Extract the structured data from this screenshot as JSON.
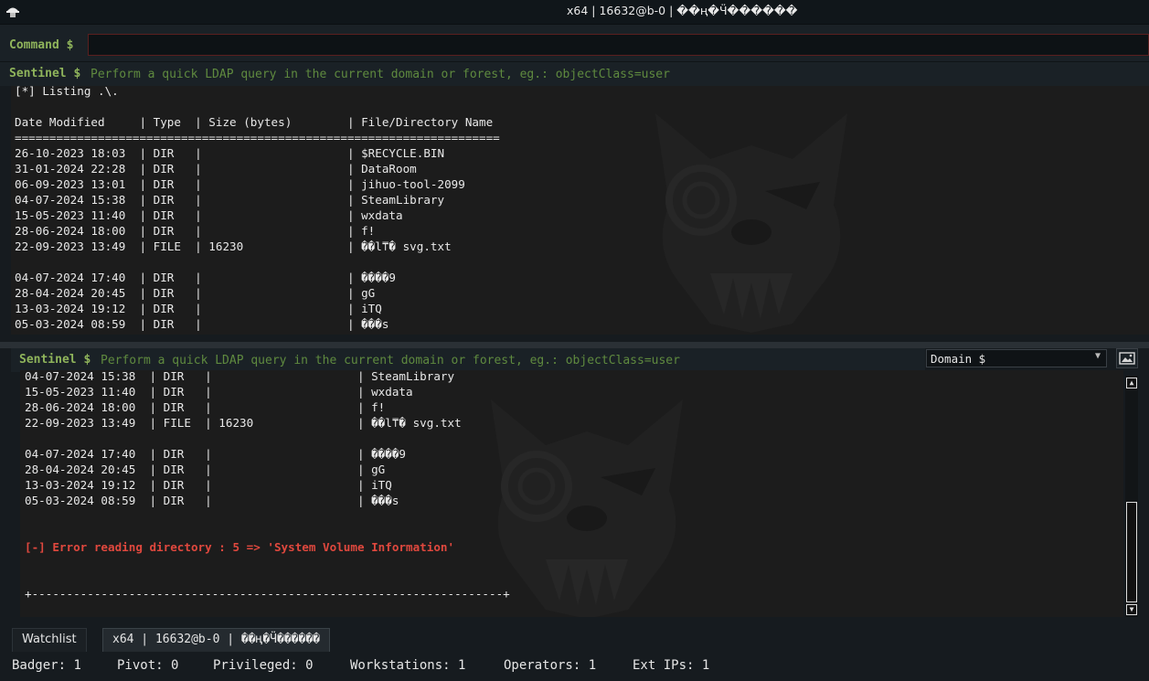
{
  "window": {
    "title": "x64 | 16632@b-0 | ��ң�Ӵ������",
    "app_icon": "hacker-hat-icon"
  },
  "command_bar": {
    "label": "Command  $",
    "value": "",
    "placeholder": ""
  },
  "top_panel": {
    "prompt_label": "Sentinel $",
    "prompt_placeholder": "Perform a quick LDAP query in the current domain or forest, eg.: objectClass=user",
    "lines": [
      "[*] Listing .\\.",
      "",
      "Date Modified     | Type  | Size (bytes)        | File/Directory Name",
      "======================================================================",
      "26-10-2023 18:03  | DIR   |                     | $RECYCLE.BIN",
      "31-01-2024 22:28  | DIR   |                     | DataRoom",
      "06-09-2023 13:01  | DIR   |                     | jihuo-tool-2099",
      "04-07-2024 15:38  | DIR   |                     | SteamLibrary",
      "15-05-2023 11:40  | DIR   |                     | wxdata",
      "28-06-2024 18:00  | DIR   |                     | f!",
      "22-09-2023 13:49  | FILE  | 16230               | ��l⍑� svg.txt",
      "",
      "04-07-2024 17:40  | DIR   |                     | ����9",
      "28-04-2024 20:45  | DIR   |                     | gG",
      "13-03-2024 19:12  | DIR   |                     | iTQ",
      "05-03-2024 08:59  | DIR   |                     | ���s"
    ]
  },
  "bottom_panel": {
    "prompt_label": "Sentinel $",
    "prompt_placeholder": "Perform a quick LDAP query in the current domain or forest, eg.: objectClass=user",
    "domain_select": "Domain $",
    "lines": [
      "04-07-2024 15:38  | DIR   |                     | SteamLibrary",
      "15-05-2023 11:40  | DIR   |                     | wxdata",
      "28-06-2024 18:00  | DIR   |                     | f!",
      "22-09-2023 13:49  | FILE  | 16230               | ��l⍑� svg.txt",
      "",
      "04-07-2024 17:40  | DIR   |                     | ����9",
      "28-04-2024 20:45  | DIR   |                     | gG",
      "13-03-2024 19:12  | DIR   |                     | iTQ",
      "05-03-2024 08:59  | DIR   |                     | ���s",
      "",
      ""
    ],
    "error_line": "[-] Error reading directory : 5 => 'System Volume Information'",
    "footer_line": "+--------------------------------------------------------------------+"
  },
  "tabs": [
    {
      "label": "Watchlist"
    },
    {
      "label": "x64 | 16632@b-0 | ��ң�Ӵ������"
    }
  ],
  "status": [
    {
      "label": "Badger:",
      "value": "1"
    },
    {
      "label": "Pivot:",
      "value": "0"
    },
    {
      "label": "Privileged:",
      "value": "0"
    },
    {
      "label": "Workstations:",
      "value": "1"
    },
    {
      "label": "Operators:",
      "value": "1"
    },
    {
      "label": "Ext IPs:",
      "value": "1"
    }
  ],
  "colors": {
    "prompt_green": "#8fb45b",
    "error_red": "#e0483e",
    "console_bg": "#1c1c1c"
  }
}
